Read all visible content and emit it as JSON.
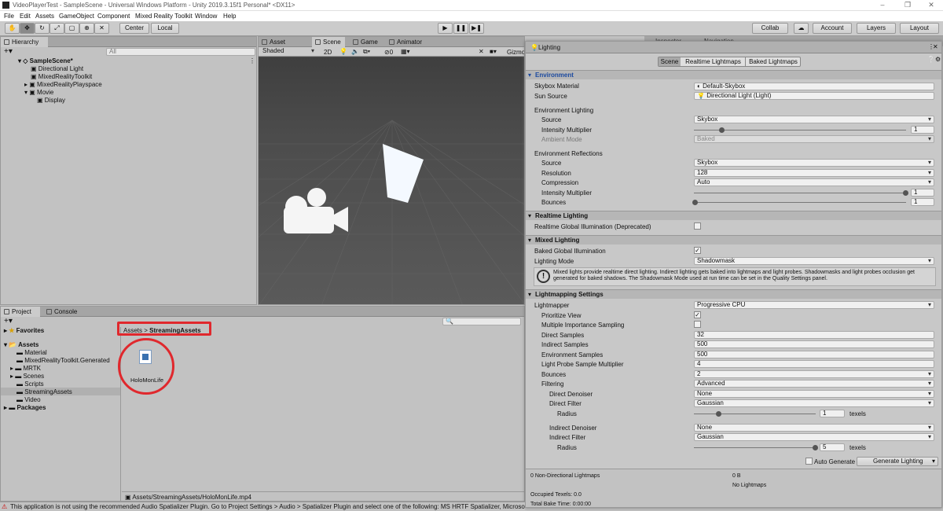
{
  "window": {
    "title": "VideoPlayerTest - SampleScene - Universal Windows Platform - Unity 2019.3.15f1 Personal* <DX11>"
  },
  "menu": [
    "File",
    "Edit",
    "Assets",
    "GameObject",
    "Component",
    "Mixed Reality Toolkit",
    "Window",
    "Help"
  ],
  "toolbar": {
    "center": "Center",
    "local": "Local",
    "collab": "Collab",
    "account": "Account",
    "layers": "Layers",
    "layout": "Layout"
  },
  "hierarchy": {
    "tab": "Hierarchy",
    "search_placeholder": "All",
    "items": [
      {
        "label": "SampleScene*"
      },
      {
        "label": "Directional Light"
      },
      {
        "label": "MixedRealityToolkit"
      },
      {
        "label": "MixedRealityPlayspace"
      },
      {
        "label": "Movie"
      },
      {
        "label": "Display"
      }
    ]
  },
  "scene": {
    "tabs": [
      "Asset Store",
      "Scene",
      "Game",
      "Animator"
    ],
    "shaded": "Shaded",
    "mode2d": "2D",
    "gizmos": "Gizmo",
    "hidden_count": "0"
  },
  "project": {
    "tabs": [
      "Project",
      "Console"
    ],
    "favorites": "Favorites",
    "tree": [
      "Assets",
      "Material",
      "MixedRealityToolkit.Generated",
      "MRTK",
      "Scenes",
      "Scripts",
      "StreamingAssets",
      "Video",
      "Packages"
    ],
    "breadcrumb": [
      "Assets",
      "StreamingAssets"
    ],
    "file": "HoloMonLife",
    "path": "Assets/StreamingAssets/HoloMonLife.mp4"
  },
  "inspector_tabs": [
    "Inspector",
    "Navigation"
  ],
  "lighting": {
    "title": "Lighting",
    "subtabs": [
      "Scene",
      "Realtime Lightmaps",
      "Baked Lightmaps"
    ],
    "environment": {
      "header": "Environment",
      "skybox_label": "Skybox Material",
      "skybox_value": "Default-Skybox",
      "sun_label": "Sun Source",
      "sun_value": "Directional Light (Light)",
      "env_lighting": "Environment Lighting",
      "source_label": "Source",
      "source_value": "Skybox",
      "intensity_label": "Intensity Multiplier",
      "intensity_value": "1",
      "ambient_label": "Ambient Mode",
      "ambient_value": "Baked",
      "env_reflections": "Environment Reflections",
      "refl_source_value": "Skybox",
      "resolution_label": "Resolution",
      "resolution_value": "128",
      "compression_label": "Compression",
      "compression_value": "Auto",
      "refl_intensity_value": "1",
      "bounces_label": "Bounces",
      "bounces_value": "1"
    },
    "realtime": {
      "header": "Realtime Lighting",
      "gi_label": "Realtime Global Illumination (Deprecated)"
    },
    "mixed": {
      "header": "Mixed Lighting",
      "baked_gi_label": "Baked Global Illumination",
      "mode_label": "Lighting Mode",
      "mode_value": "Shadowmask",
      "info": "Mixed lights provide realtime direct lighting. Indirect lighting gets baked into lightmaps and light probes. Shadowmasks and light probes occlusion get generated for baked shadows. The Shadowmask Mode used at run time can be set in the Quality Settings panel."
    },
    "lightmapping": {
      "header": "Lightmapping Settings",
      "lightmapper_label": "Lightmapper",
      "lightmapper_value": "Progressive CPU",
      "prioritize_label": "Prioritize View",
      "mis_label": "Multiple Importance Sampling",
      "direct_label": "Direct Samples",
      "direct_value": "32",
      "indirect_label": "Indirect Samples",
      "indirect_value": "500",
      "env_samples_label": "Environment Samples",
      "env_samples_value": "500",
      "probe_label": "Light Probe Sample Multiplier",
      "probe_value": "4",
      "bounces_label": "Bounces",
      "bounces_value": "2",
      "filtering_label": "Filtering",
      "filtering_value": "Advanced",
      "direct_denoiser_label": "Direct Denoiser",
      "direct_denoiser_value": "None",
      "direct_filter_label": "Direct Filter",
      "direct_filter_value": "Gaussian",
      "radius_label": "Radius",
      "direct_radius_value": "1",
      "texels": "texels",
      "indirect_denoiser_label": "Indirect Denoiser",
      "indirect_denoiser_value": "None",
      "indirect_filter_label": "Indirect Filter",
      "indirect_filter_value": "Gaussian",
      "indirect_radius_value": "5"
    },
    "auto_generate": "Auto Generate",
    "generate_button": "Generate Lighting",
    "stats": {
      "nondirectional": "0 Non-Directional Lightmaps",
      "size": "0 B",
      "no_lightmaps": "No Lightmaps",
      "occupied": "Occupied Texels: 0.0",
      "bake_time": "Total Bake Time: 0:00:00"
    }
  },
  "status": {
    "text": "This application is not using the recommended Audio Spatializer Plugin. Go to Project Settings > Audio > Spatializer Plugin and select one of the following: MS HRTF Spatializer, Microsoft S"
  },
  "colors": {
    "highlight": "#e0282d",
    "accent": "#3a72b0"
  }
}
